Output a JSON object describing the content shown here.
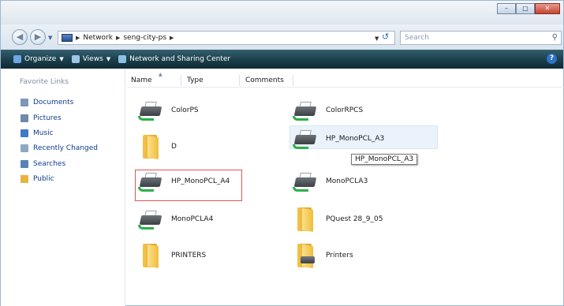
{
  "address_bar": {
    "segments": [
      "Network",
      "seng-city-ps"
    ],
    "search_placeholder": "Search"
  },
  "command_bar": {
    "organize": "Organize",
    "views": "Views",
    "network_center": "Network and Sharing Center"
  },
  "nav_pane": {
    "header": "Favorite Links",
    "items": [
      "Documents",
      "Pictures",
      "Music",
      "Recently Changed",
      "Searches",
      "Public"
    ]
  },
  "columns": [
    "Name",
    "Type",
    "Comments"
  ],
  "items": [
    {
      "label": "ColorPS",
      "icon": "printer-icon"
    },
    {
      "label": "ColorRPCS",
      "icon": "printer-icon"
    },
    {
      "label": "D",
      "icon": "folder-icon"
    },
    {
      "label": "HP_MonoPCL_A3",
      "icon": "printer-icon"
    },
    {
      "label": "HP_MonoPCL_A4",
      "icon": "printer-icon"
    },
    {
      "label": "MonoPCLA3",
      "icon": "printer-icon"
    },
    {
      "label": "MonoPCLA4",
      "icon": "printer-icon"
    },
    {
      "label": "PQuest 28_9_05",
      "icon": "folder-icon"
    },
    {
      "label": "PRINTERS",
      "icon": "folder-icon"
    },
    {
      "label": "Printers",
      "icon": "printers-folder-icon"
    }
  ],
  "tooltip": "HP_MonoPCL_A3",
  "colors": {
    "command_bar": "#1b3e4b",
    "link": "#0f3c8a",
    "selection_outline": "#e0564f",
    "hover_fill": "#eaf3fb"
  }
}
